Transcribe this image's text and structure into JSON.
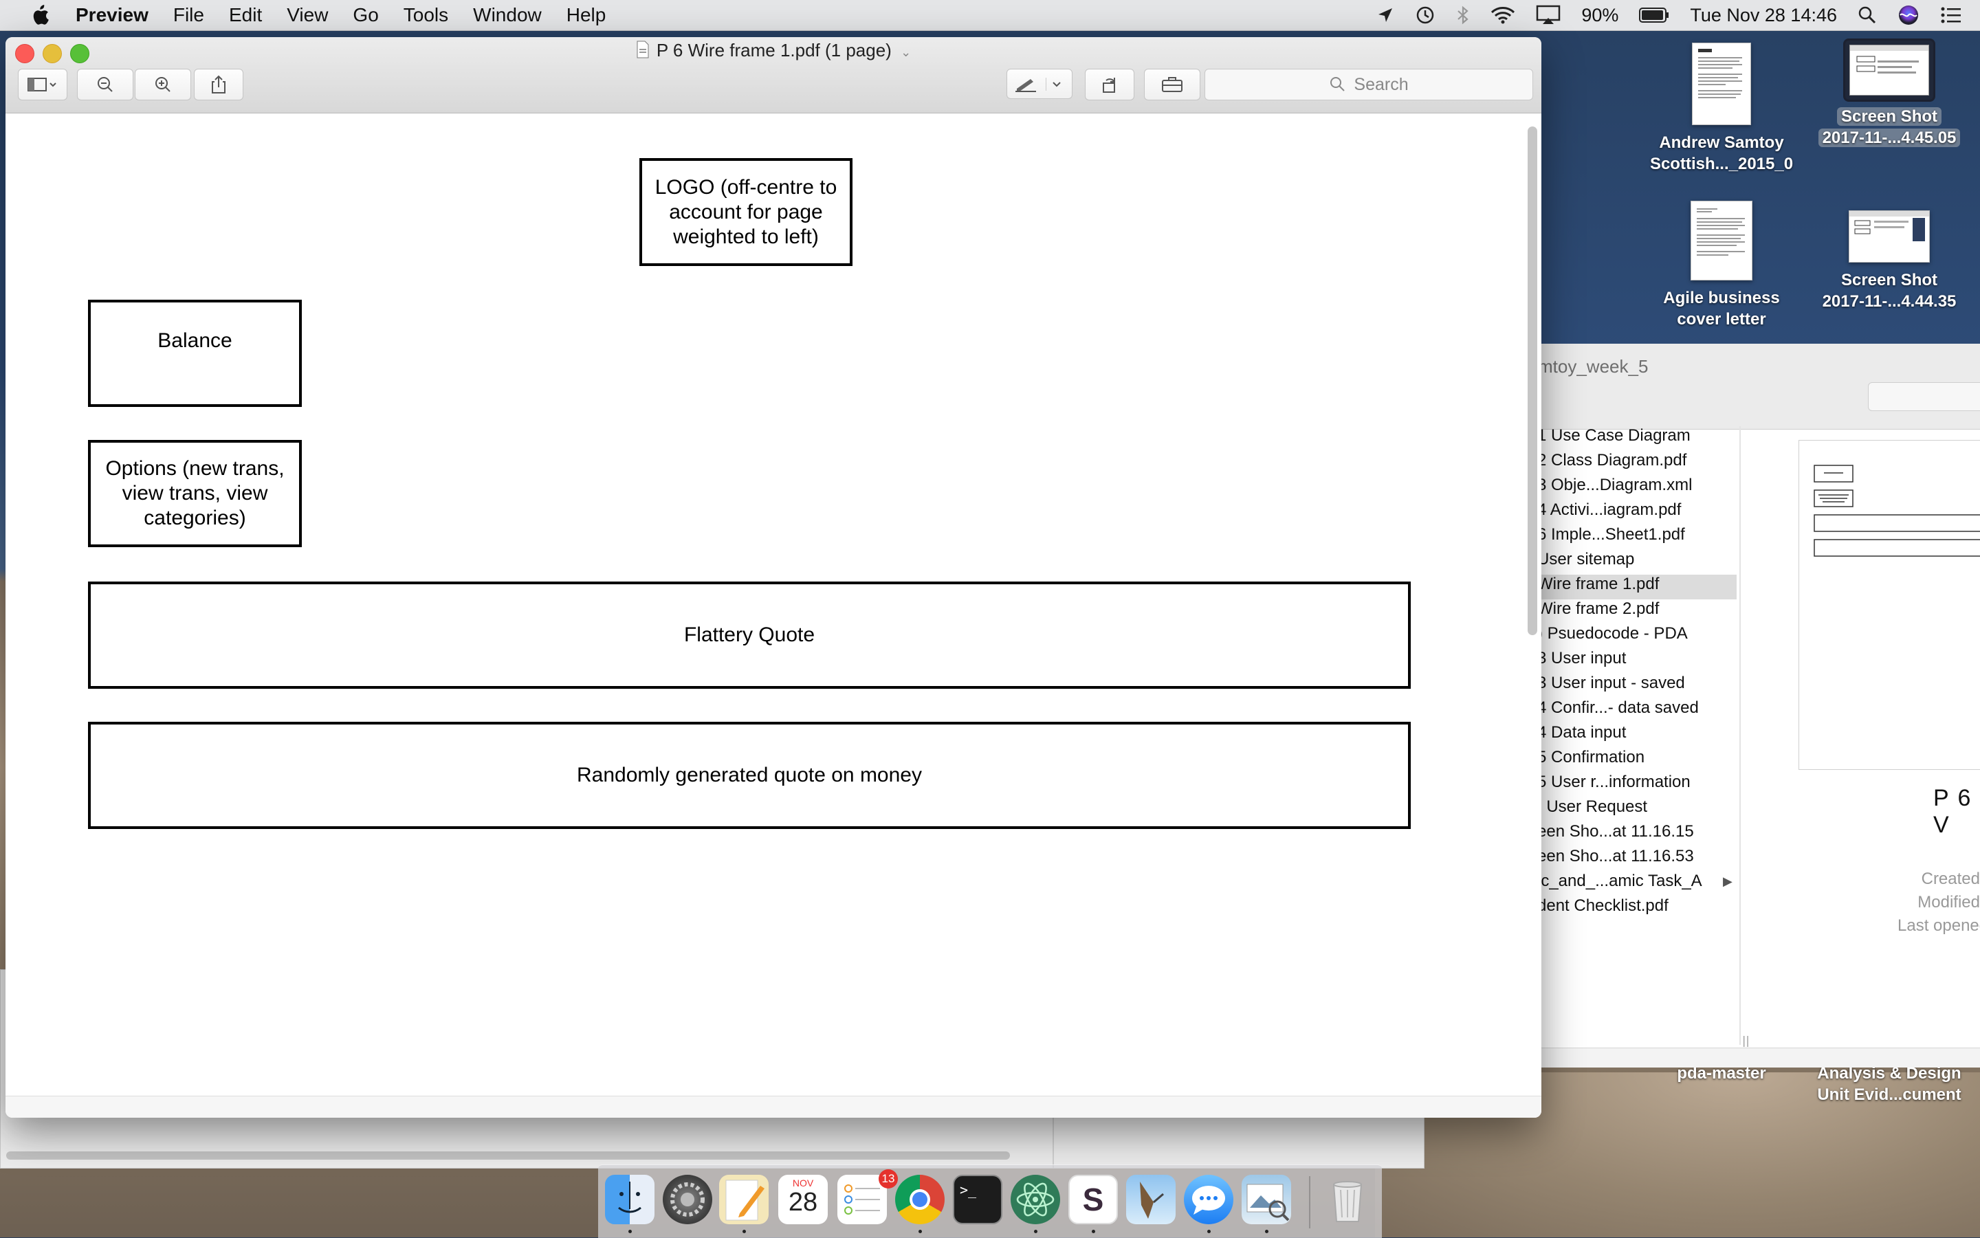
{
  "menubar": {
    "app": "Preview",
    "items": [
      "File",
      "Edit",
      "View",
      "Go",
      "Tools",
      "Window",
      "Help"
    ],
    "battery": "90%",
    "datetime": "Tue Nov 28  14:46"
  },
  "window": {
    "title": "P 6 Wire frame 1.pdf (1 page)",
    "search_placeholder": "Search"
  },
  "document": {
    "logo": "LOGO (off-centre to account for page weighted to left)",
    "balance": "Balance",
    "options": "Options (new trans, view trans, view categories)",
    "flattery": "Flattery Quote",
    "random": "Randomly generated quote on money"
  },
  "desktop": {
    "icons": [
      {
        "line1": "Andrew Samtoy",
        "line2": "Scottish..._2015_0"
      },
      {
        "line1": "Screen Shot",
        "line2": "2017-11-...4.45.05"
      },
      {
        "line1": "Agile business",
        "line2": "cover letter"
      },
      {
        "line1": "Screen Shot",
        "line2": "2017-11-...4.44.35"
      },
      {
        "line1": "pda-master",
        "line2": ""
      },
      {
        "line1": "Analysis & Design",
        "line2": "Unit Evid...cument"
      }
    ]
  },
  "finder": {
    "crumb": "mtoy_week_5",
    "files": [
      "1 Use Case Diagram",
      "2 Class Diagram.pdf",
      "3 Obje...Diagram.xml",
      "4 Activi...iagram.pdf",
      "6 Imple...Sheet1.pdf",
      "User sitemap",
      "Wire frame 1.pdf",
      "Wire frame 2.pdf",
      ") Psuedocode - PDA",
      "3 User input",
      "3 User input - saved",
      "4 Confir...- data saved",
      "4 Data input",
      "5 Confirmation",
      "5 User r...information",
      "; User Request",
      "een Sho...at 11.16.15",
      "een Sho...at 11.16.53",
      "ic_and_...amic Task_A",
      "dent Checklist.pdf"
    ],
    "preview_name": "P 6 V",
    "meta": [
      "Created",
      "Modified",
      "Last opened"
    ]
  },
  "dock": {
    "reminders_badge": "13",
    "calendar_month": "NOV",
    "calendar_day": "28"
  }
}
